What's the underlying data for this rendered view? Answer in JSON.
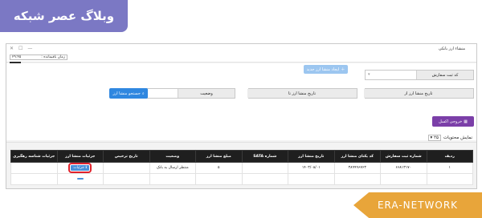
{
  "watermark_top": "وبلاگ عصر شبکه",
  "watermark_bottom": "ERA-NETWORK",
  "window": {
    "title": "منشاء ارز بانکی",
    "controls": [
      "✕",
      "☐",
      "—"
    ]
  },
  "timer": {
    "label": "زمان باقیمانده :",
    "value": "۲۹:۴۵"
  },
  "filters": {
    "order_code_label": "کد ثبت سفارش",
    "from_date_label": "تاریخ منشا ارز از",
    "to_date_label": "تاریخ منشا ارز تا",
    "status_label": "وضعیت",
    "new_request_button": "ایجاد منشا ارز جدید",
    "search_button": "جستجو منشا ارز"
  },
  "excel_button": "خروجی اکسل",
  "page_size": {
    "label": "نمایش محتویات",
    "value": "۲۵"
  },
  "table": {
    "headers": [
      "ردیف",
      "شماره ثبت سفارش",
      "کد یکتای منشا ارز",
      "تاریخ منشا ارز",
      "شماره SATA",
      "مبلغ منشا ارز",
      "وضعیت",
      "تاریخ ترخیص",
      "جزئیات منشا ارز",
      "جزئیات شناسه رهگیری"
    ],
    "rows": [
      {
        "index": "۱",
        "order_no": "۶۶۸۱۳۱۷۰",
        "unique_code": "۳۸۹۹۹۶۷۶۳",
        "date": "۱۴۰۳/۰۸/۰۱",
        "sata": "",
        "amount": "۵",
        "status": "منتظر ارسال به بانک",
        "clearance_date": "",
        "detail": "جزئیات",
        "tracking": ""
      }
    ]
  }
}
